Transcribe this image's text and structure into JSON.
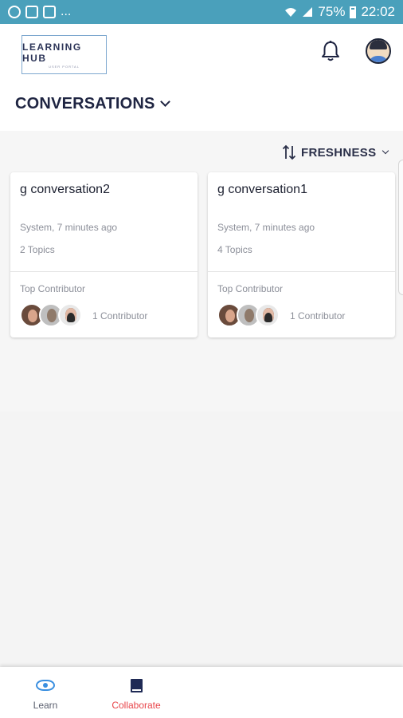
{
  "status_bar": {
    "left_icons": [
      "settings-notification-icon",
      "image-notification-icon",
      "mail-notification-icon"
    ],
    "overflow": "...",
    "battery": "75%",
    "time": "22:02"
  },
  "header": {
    "logo_title": "LEARNING HUB",
    "logo_subtitle": "USER PORTAL",
    "title": "CONVERSATIONS"
  },
  "sort": {
    "label": "FRESHNESS"
  },
  "conversations": [
    {
      "title": "g conversation2",
      "meta": "System, 7 minutes ago",
      "topics": "2 Topics",
      "top_contributor_label": "Top Contributor",
      "contributors": "1 Contributor"
    },
    {
      "title": "g conversation1",
      "meta": "System, 7 minutes ago",
      "topics": "4 Topics",
      "top_contributor_label": "Top Contributor",
      "contributors": "1 Contributor"
    }
  ],
  "bottom_nav": {
    "items": [
      {
        "label": "Learn",
        "icon": "eye-icon",
        "active": false
      },
      {
        "label": "Collaborate",
        "icon": "book-icon",
        "active": true
      }
    ]
  },
  "colors": {
    "status_bar": "#4aa0bb",
    "accent_active": "#e8454a",
    "learn_icon": "#3a8fe0",
    "title_text": "#1f2542"
  }
}
